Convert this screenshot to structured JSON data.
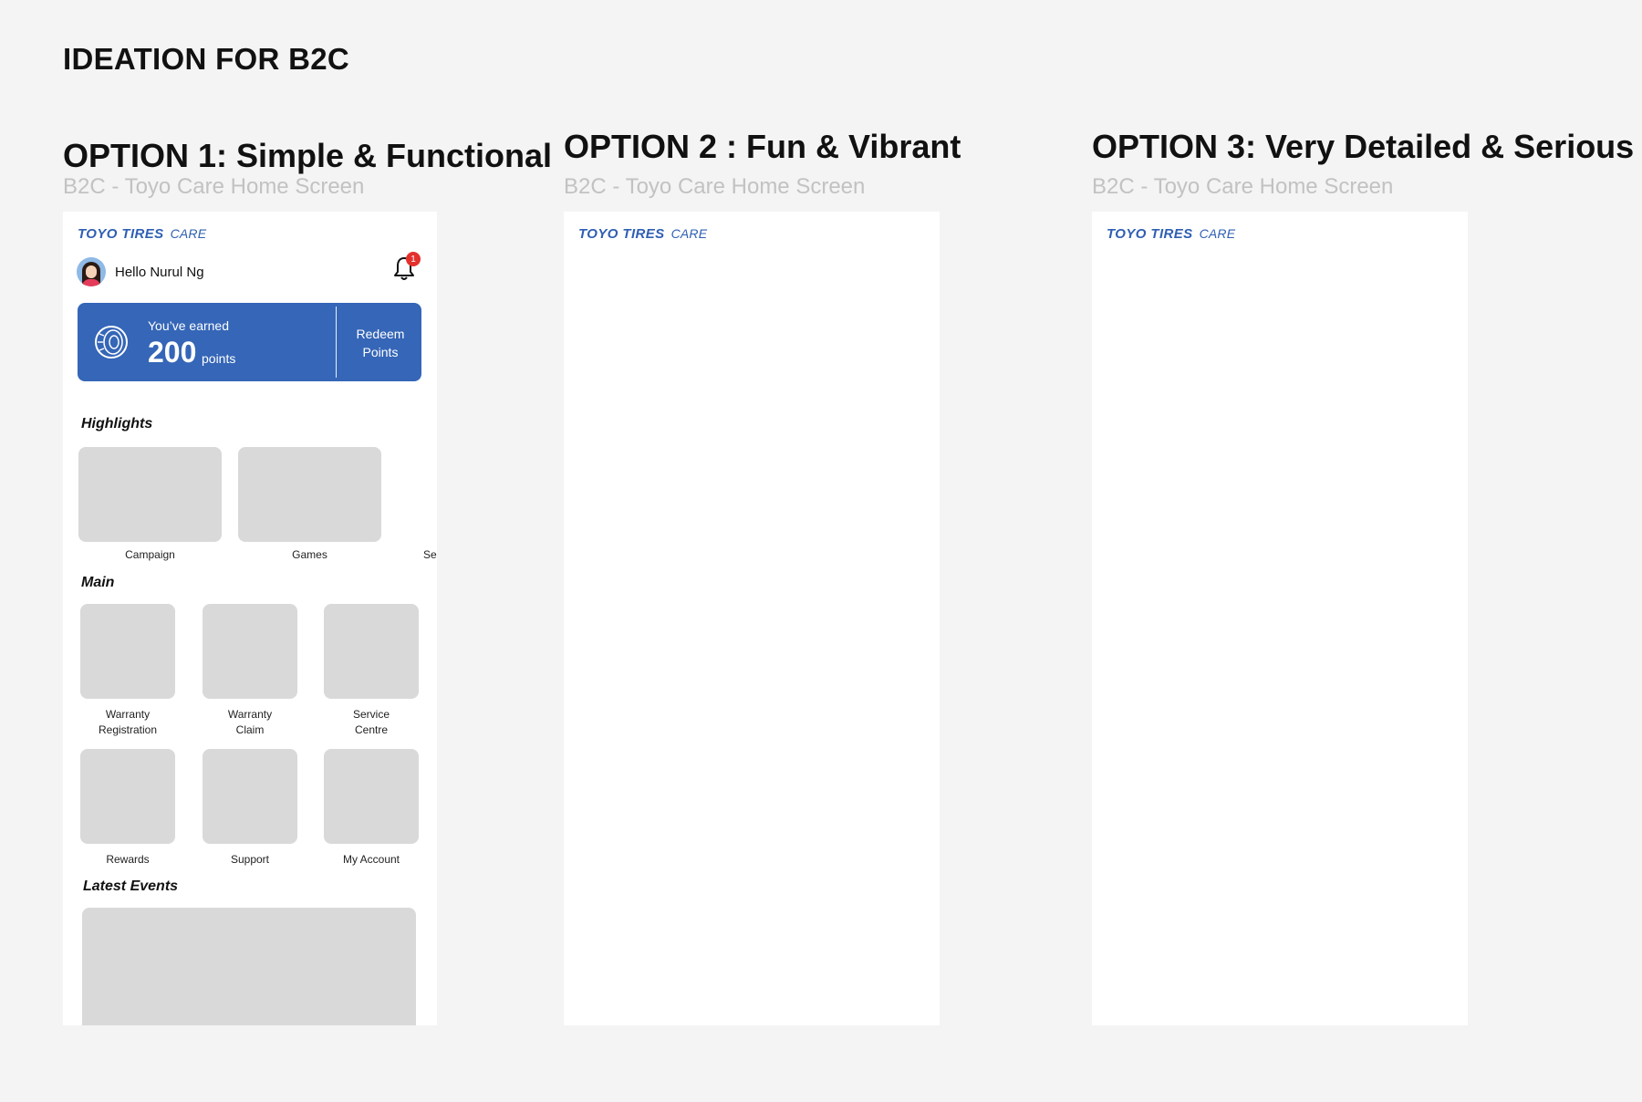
{
  "page": {
    "title": "IDEATION FOR B2C"
  },
  "options": [
    {
      "title": "OPTION 1: Simple & Functional",
      "subtitle": "B2C - Toyo Care Home Screen"
    },
    {
      "title": "OPTION 2 : Fun & Vibrant",
      "subtitle": "B2C - Toyo Care Home Screen"
    },
    {
      "title": "OPTION 3: Very Detailed & Serious",
      "subtitle": "B2C - Toyo Care Home Screen"
    }
  ],
  "logo": {
    "brand": "TOYO TIRES",
    "suffix": "CARE",
    "color": "#2f5fb3"
  },
  "home": {
    "greeting": "Hello Nurul Ng",
    "notification_count": "1",
    "points_card": {
      "earned_label": "You’ve earned",
      "points": "200",
      "points_unit": "points",
      "redeem_label": "Redeem\nPoints",
      "color": "#3566b7"
    },
    "highlights": {
      "heading": "Highlights",
      "items": [
        "Campaign",
        "Games",
        "Ser"
      ]
    },
    "main": {
      "heading": "Main",
      "items": [
        "Warranty\nRegistration",
        "Warranty\nClaim",
        "Service\nCentre",
        "Rewards",
        "Support",
        "My Account"
      ]
    },
    "latest_events": {
      "heading": "Latest Events"
    }
  }
}
